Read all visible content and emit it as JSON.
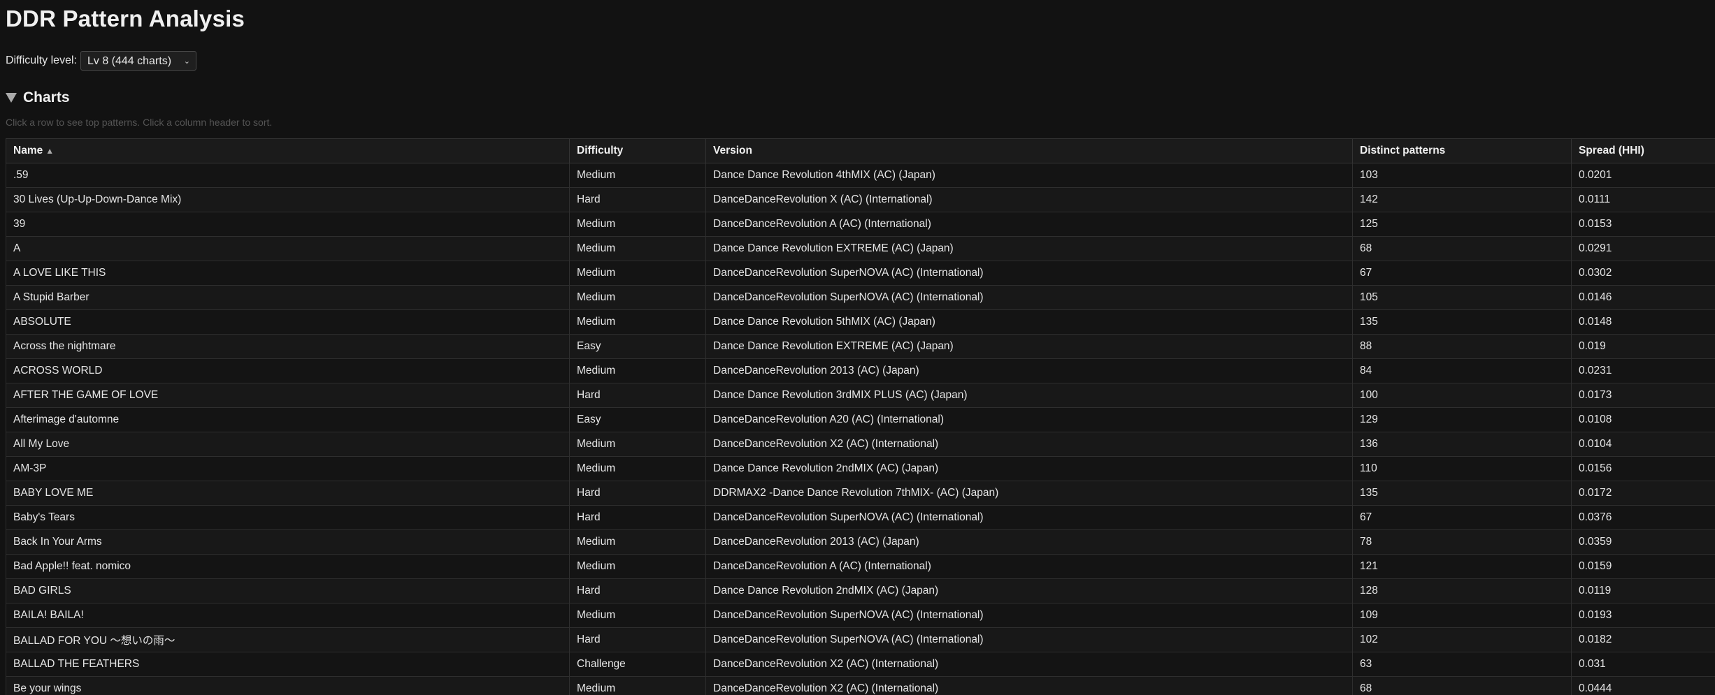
{
  "page": {
    "title": "DDR Pattern Analysis"
  },
  "filter": {
    "label": "Difficulty level:",
    "selected": "Lv 8 (444 charts)"
  },
  "section": {
    "title": "Charts",
    "hint": "Click a row to see top patterns. Click a column header to sort."
  },
  "table": {
    "columns": [
      "Name",
      "Difficulty",
      "Version",
      "Distinct patterns",
      "Spread (HHI)"
    ],
    "sort_indicator": "▲",
    "rows": [
      [
        ".59",
        "Medium",
        "Dance Dance Revolution 4thMIX (AC) (Japan)",
        "103",
        "0.0201"
      ],
      [
        "30 Lives (Up-Up-Down-Dance Mix)",
        "Hard",
        "DanceDanceRevolution X (AC) (International)",
        "142",
        "0.0111"
      ],
      [
        "39",
        "Medium",
        "DanceDanceRevolution A (AC) (International)",
        "125",
        "0.0153"
      ],
      [
        "A",
        "Medium",
        "Dance Dance Revolution EXTREME (AC) (Japan)",
        "68",
        "0.0291"
      ],
      [
        "A LOVE LIKE THIS",
        "Medium",
        "DanceDanceRevolution SuperNOVA (AC) (International)",
        "67",
        "0.0302"
      ],
      [
        "A Stupid Barber",
        "Medium",
        "DanceDanceRevolution SuperNOVA (AC) (International)",
        "105",
        "0.0146"
      ],
      [
        "ABSOLUTE",
        "Medium",
        "Dance Dance Revolution 5thMIX (AC) (Japan)",
        "135",
        "0.0148"
      ],
      [
        "Across the nightmare",
        "Easy",
        "Dance Dance Revolution EXTREME (AC) (Japan)",
        "88",
        "0.019"
      ],
      [
        "ACROSS WORLD",
        "Medium",
        "DanceDanceRevolution 2013 (AC) (Japan)",
        "84",
        "0.0231"
      ],
      [
        "AFTER THE GAME OF LOVE",
        "Hard",
        "Dance Dance Revolution 3rdMIX PLUS (AC) (Japan)",
        "100",
        "0.0173"
      ],
      [
        "Afterimage d'automne",
        "Easy",
        "DanceDanceRevolution A20 (AC) (International)",
        "129",
        "0.0108"
      ],
      [
        "All My Love",
        "Medium",
        "DanceDanceRevolution X2 (AC) (International)",
        "136",
        "0.0104"
      ],
      [
        "AM-3P",
        "Medium",
        "Dance Dance Revolution 2ndMIX (AC) (Japan)",
        "110",
        "0.0156"
      ],
      [
        "BABY LOVE ME",
        "Hard",
        "DDRMAX2 -Dance Dance Revolution 7thMIX- (AC) (Japan)",
        "135",
        "0.0172"
      ],
      [
        "Baby's Tears",
        "Hard",
        "DanceDanceRevolution SuperNOVA (AC) (International)",
        "67",
        "0.0376"
      ],
      [
        "Back In Your Arms",
        "Medium",
        "DanceDanceRevolution 2013 (AC) (Japan)",
        "78",
        "0.0359"
      ],
      [
        "Bad Apple!! feat. nomico",
        "Medium",
        "DanceDanceRevolution A (AC) (International)",
        "121",
        "0.0159"
      ],
      [
        "BAD GIRLS",
        "Hard",
        "Dance Dance Revolution 2ndMIX (AC) (Japan)",
        "128",
        "0.0119"
      ],
      [
        "BAILA! BAILA!",
        "Medium",
        "DanceDanceRevolution SuperNOVA (AC) (International)",
        "109",
        "0.0193"
      ],
      [
        "BALLAD FOR YOU ～想いの雨～",
        "Hard",
        "DanceDanceRevolution SuperNOVA (AC) (International)",
        "102",
        "0.0182"
      ],
      [
        "BALLAD THE FEATHERS",
        "Challenge",
        "DanceDanceRevolution X2 (AC) (International)",
        "63",
        "0.031"
      ],
      [
        "Be your wings",
        "Medium",
        "DanceDanceRevolution X2 (AC) (International)",
        "68",
        "0.0444"
      ]
    ]
  }
}
